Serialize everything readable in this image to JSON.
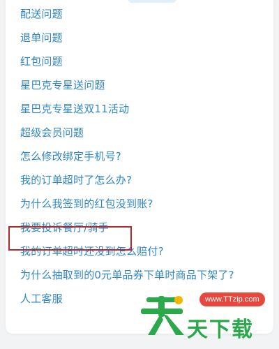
{
  "faq": {
    "items": [
      {
        "label": "配送问题"
      },
      {
        "label": "退单问题"
      },
      {
        "label": "红包问题"
      },
      {
        "label": "星巴克专星送问题"
      },
      {
        "label": "星巴克专星送双11活动"
      },
      {
        "label": "超级会员问题"
      },
      {
        "label": "怎么修改绑定手机号?"
      },
      {
        "label": "我的订单超时了怎么办?"
      },
      {
        "label": "为什么我签到的红包没到账?"
      },
      {
        "label": "我要投诉餐厅/骑手"
      },
      {
        "label": "我的订单超时还没到怎么赔付?"
      },
      {
        "label": "为什么抽取到的0元单品券下单时商品下架了?"
      },
      {
        "label": "人工客服"
      }
    ],
    "highlighted_index": 9
  },
  "colors": {
    "link": "#2f86c7",
    "highlight_border": "#b02a30",
    "watermark_green": "#2aa84a",
    "watermark_red": "#e8473e"
  },
  "watermark": {
    "url": "www.TTzip.com",
    "site_name": "天下载",
    "logo_char": "天"
  }
}
